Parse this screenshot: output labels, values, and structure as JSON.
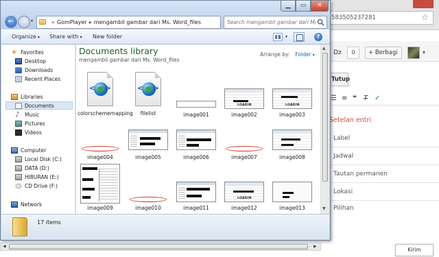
{
  "browser": {
    "url_fragment": "583505237281",
    "dz_label": "Dz",
    "count": "0",
    "share_label": "Berbagi",
    "close_button": "Tutup",
    "settings_title": "Setelan entri",
    "options": [
      "Label",
      "Jadwal",
      "Tautan permanen",
      "Lokasi",
      "Pilihan"
    ],
    "feedback_button": "Kirim masukan"
  },
  "explorer": {
    "address": {
      "root": "GomPlayer",
      "folder": "mengambil gambar dari Ms. Word_files"
    },
    "search_placeholder": "Search mengambil gambar dari Ms. Word_files",
    "commands": {
      "organize": "Organize",
      "share": "Share with",
      "new_folder": "New folder"
    },
    "sidebar": {
      "favorites": "Favorites",
      "desktop": "Desktop",
      "downloads": "Downloads",
      "recent": "Recent Places",
      "libraries": "Libraries",
      "documents": "Documents",
      "music": "Music",
      "pictures": "Pictures",
      "videos": "Videos",
      "computer": "Computer",
      "local_disk": "Local Disk (C:)",
      "data": "DATA (D:)",
      "hiburan": "HIBURAN (E:)",
      "cd_drive": "CD Drive (F:)",
      "network": "Network"
    },
    "library_title": "Documents library",
    "library_subtitle": "mengambil gambar dari Ms. Word_files",
    "arrange_label": "Arrange by:",
    "arrange_value": "Folder",
    "files": {
      "f1": "colorschememapping",
      "f2": "filelist",
      "f3": "image001",
      "f4": "image002",
      "f5": "image003",
      "f6": "image004",
      "f7": "image005",
      "f8": "image006",
      "f9": "image007",
      "f10": "image008",
      "f11": "image009",
      "f12": "image010",
      "f13": "image011",
      "f14": "image012",
      "f15": "image013"
    },
    "loadin_text": "LOADIN",
    "item_count": "17 items"
  }
}
